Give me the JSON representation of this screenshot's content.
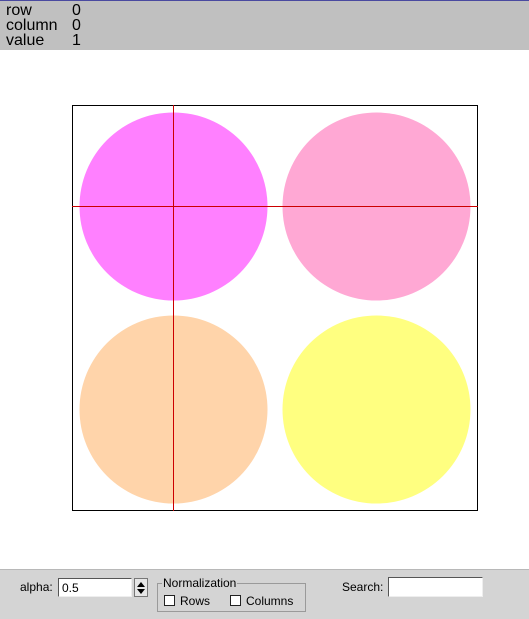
{
  "info": {
    "row_label": "row",
    "row_value": "0",
    "column_label": "column",
    "column_value": "0",
    "value_label": "value",
    "value_value": "1"
  },
  "plot": {
    "cells": [
      {
        "row": 0,
        "column": 0,
        "color": "#ff80ff"
      },
      {
        "row": 0,
        "column": 1,
        "color": "#ffa8d4"
      },
      {
        "row": 1,
        "column": 0,
        "color": "#ffd4aa"
      },
      {
        "row": 1,
        "column": 1,
        "color": "#ffff80"
      }
    ],
    "crosshair_color": "#cc0000",
    "crosshair_cell": {
      "row": 0,
      "column": 0
    }
  },
  "toolbar": {
    "alpha_label": "alpha:",
    "alpha_value": "0.5",
    "normalization_label": "Normalization",
    "rows_label": "Rows",
    "rows_checked": false,
    "columns_label": "Columns",
    "columns_checked": false,
    "search_label": "Search:",
    "search_value": ""
  }
}
